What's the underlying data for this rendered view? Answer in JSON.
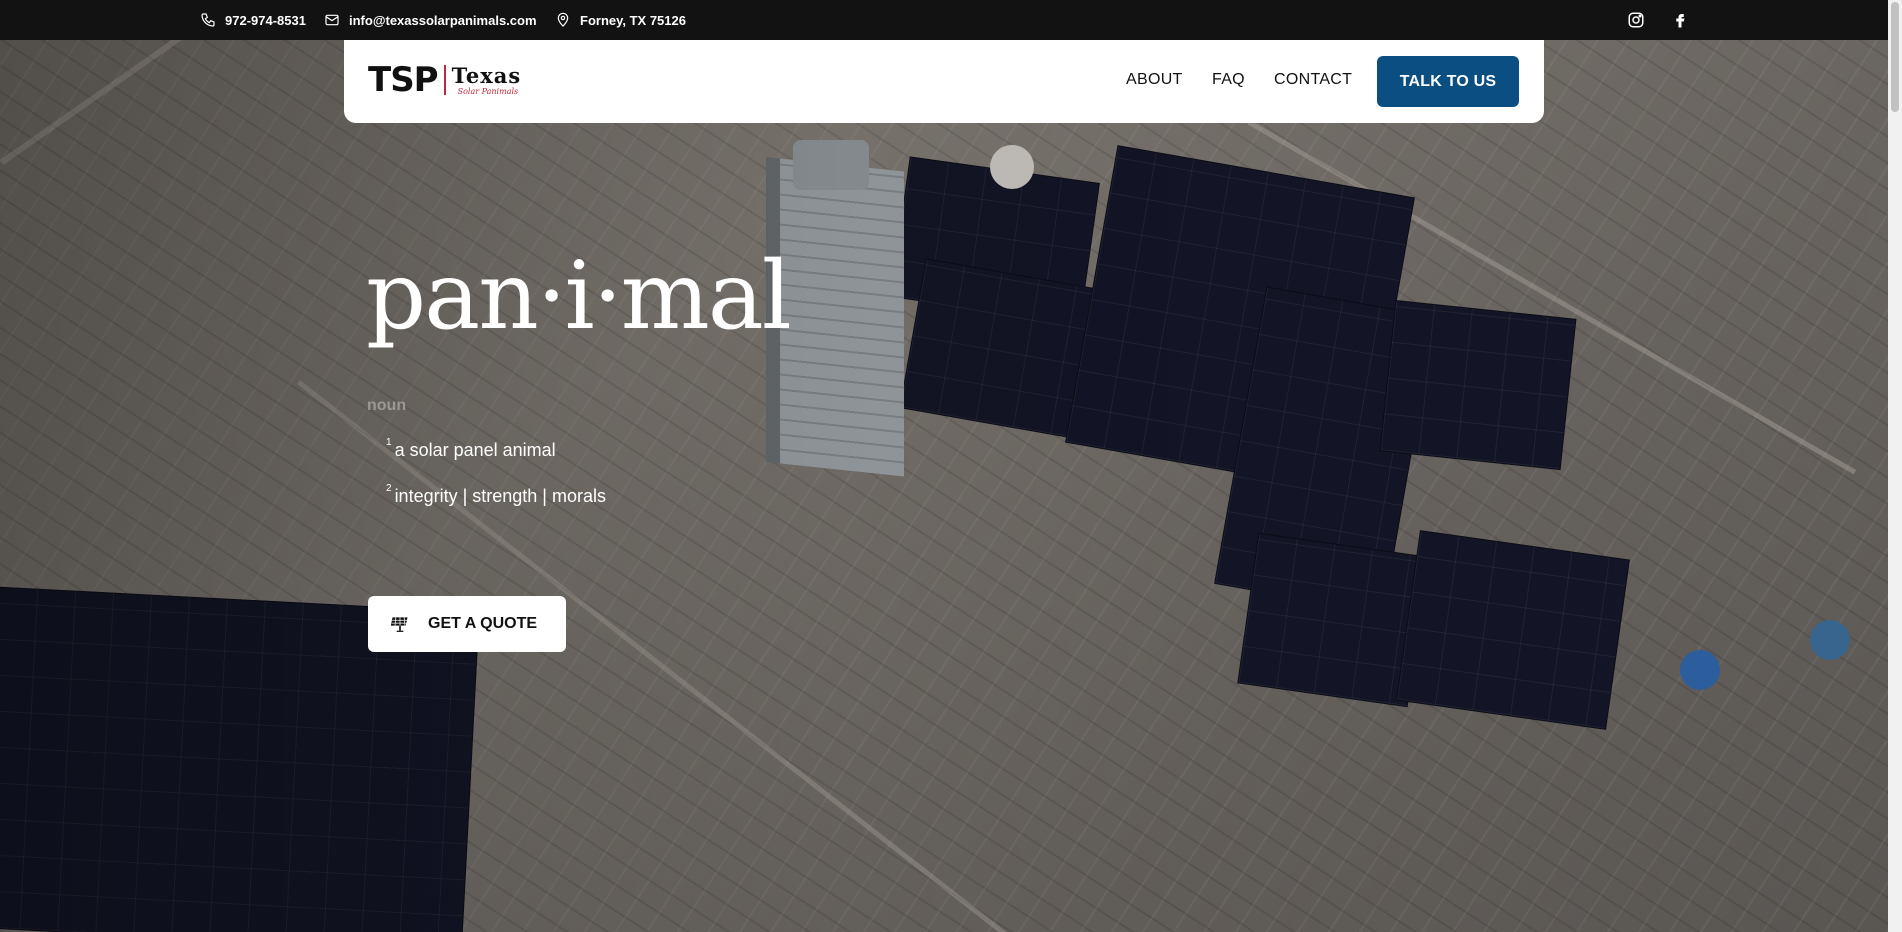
{
  "topbar": {
    "phone": "972-974-8531",
    "email": "info@texassolarpanimals.com",
    "location": "Forney, TX 75126"
  },
  "nav": {
    "logo_main": "TSP",
    "logo_texas": "Texas",
    "logo_sub": "Solar Panimals",
    "links": [
      "ABOUT",
      "FAQ",
      "CONTACT"
    ],
    "cta": "TALK TO US"
  },
  "hero": {
    "word": "pan·i·mal",
    "part_of_speech": "noun",
    "definitions": [
      {
        "num": "1",
        "text": "a solar panel animal"
      },
      {
        "num": "2",
        "text": "integrity | strength | morals"
      }
    ],
    "quote_button": "GET A QUOTE"
  },
  "colors": {
    "topbar_bg": "#121212",
    "cta_bg": "#0b4f82",
    "logo_accent": "#c0283b"
  },
  "icons": [
    "phone-icon",
    "mail-icon",
    "location-pin-icon",
    "instagram-icon",
    "facebook-icon",
    "solar-panel-icon"
  ]
}
